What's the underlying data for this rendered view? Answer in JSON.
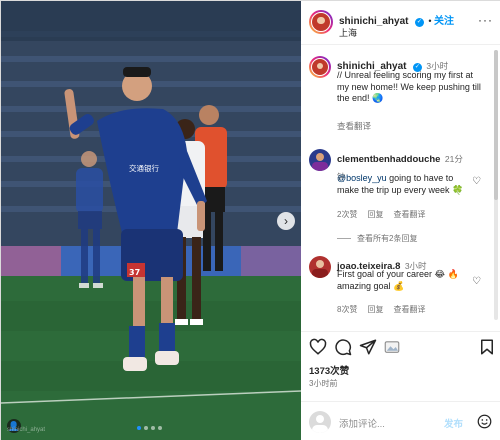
{
  "media": {
    "watermark": "shinichi_ahyat",
    "sponsor_text": "交通银行",
    "player_number": "37",
    "carousel_dots": 4,
    "active_dot": 0
  },
  "header": {
    "username": "shinichi_ahyat",
    "follow_label": "关注",
    "location": "上海"
  },
  "caption": {
    "username": "shinichi_ahyat",
    "time": "3小时",
    "text": "// Unreal feeling scoring my first at my new home!! We keep pushing till the end!",
    "translate": "查看翻译"
  },
  "comments": [
    {
      "username": "clementbenhaddouche",
      "time": "21分钟",
      "mention": "@bosley_yu",
      "text": " going to have to make the trip up every week",
      "likes": "2次赞",
      "reply": "回复",
      "translate": "查看翻译",
      "view_replies": "查看所有2条回复"
    },
    {
      "username": "joao.teixeira.8",
      "time": "3小时",
      "text": "First goal of your career",
      "text2": " amazing goal",
      "likes": "8次赞",
      "reply": "回复",
      "translate": "查看翻译"
    }
  ],
  "actions": {
    "like_count": "1373次赞",
    "posted": "3小时前",
    "add_comment_placeholder": "添加评论...",
    "post_label": "发布"
  },
  "colors": {
    "accent": "#0095f6",
    "jersey": "#1e3f8f",
    "pitch": "#2d6b3a"
  },
  "icons": [
    "more-icon",
    "heart-icon",
    "comment-icon",
    "share-icon",
    "gif-icon",
    "bookmark-icon",
    "emoji-icon",
    "verified-icon",
    "next-arrow-icon"
  ]
}
